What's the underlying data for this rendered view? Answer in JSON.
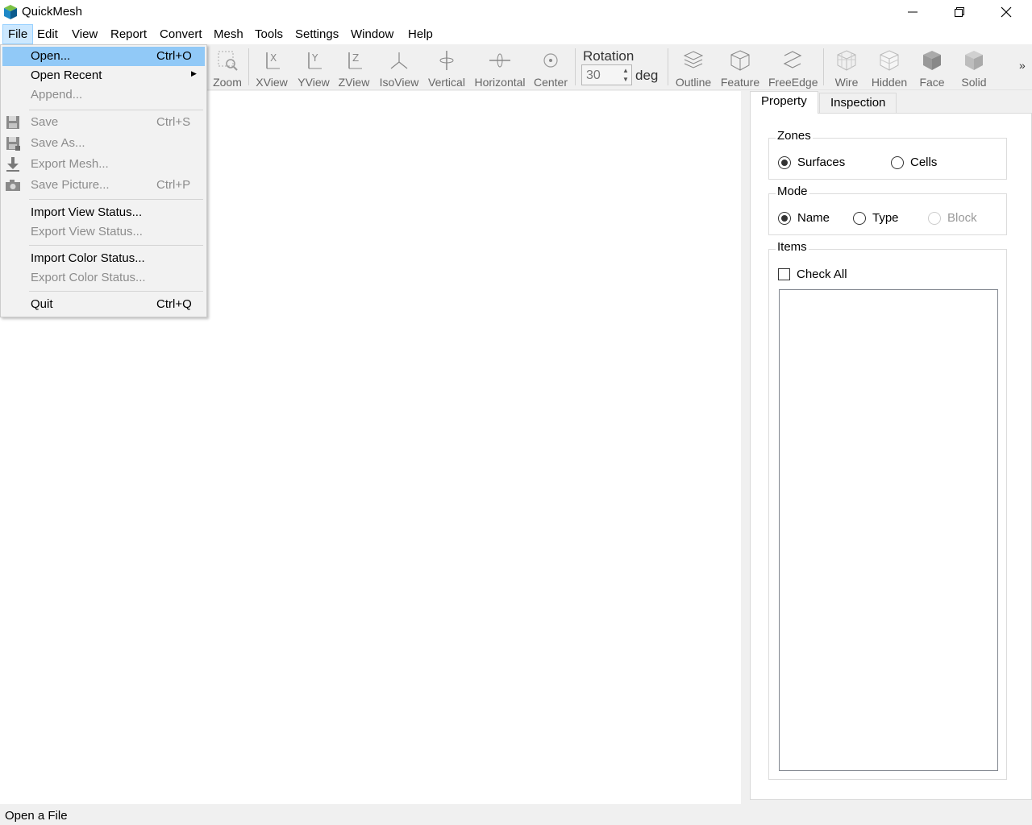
{
  "window": {
    "title": "QuickMesh"
  },
  "menubar": {
    "items": [
      "File",
      "Edit",
      "View",
      "Report",
      "Convert",
      "Mesh",
      "Tools",
      "Settings",
      "Window",
      "Help"
    ]
  },
  "toolbar": {
    "zoom": "Zoom",
    "xview": "XView",
    "yview": "YView",
    "zview": "ZView",
    "isoview": "IsoView",
    "vertical": "Vertical",
    "horizontal": "Horizontal",
    "center": "Center",
    "rotation_label": "Rotation",
    "rotation_value": "30",
    "rotation_unit": "deg",
    "outline": "Outline",
    "feature": "Feature",
    "freeedge": "FreeEdge",
    "wire": "Wire",
    "hidden": "Hidden",
    "face": "Face",
    "solid": "Solid",
    "overflow": "»"
  },
  "file_menu": {
    "open": {
      "label": "Open...",
      "shortcut": "Ctrl+O"
    },
    "open_recent": {
      "label": "Open Recent"
    },
    "append": {
      "label": "Append..."
    },
    "save": {
      "label": "Save",
      "shortcut": "Ctrl+S"
    },
    "save_as": {
      "label": "Save As..."
    },
    "export_mesh": {
      "label": "Export Mesh..."
    },
    "save_picture": {
      "label": "Save Picture...",
      "shortcut": "Ctrl+P"
    },
    "import_view_status": {
      "label": "Import View Status..."
    },
    "export_view_status": {
      "label": "Export View Status..."
    },
    "import_color_status": {
      "label": "Import Color Status..."
    },
    "export_color_status": {
      "label": "Export Color Status..."
    },
    "quit": {
      "label": "Quit",
      "shortcut": "Ctrl+Q"
    }
  },
  "panel": {
    "tabs": [
      "Property",
      "Inspection"
    ],
    "zones": {
      "title": "Zones",
      "surfaces": "Surfaces",
      "cells": "Cells",
      "selected": "Surfaces"
    },
    "mode": {
      "title": "Mode",
      "name": "Name",
      "type": "Type",
      "block": "Block",
      "selected": "Name"
    },
    "items": {
      "title": "Items",
      "check_all": "Check All"
    }
  },
  "statusbar": {
    "text": "Open a File"
  }
}
